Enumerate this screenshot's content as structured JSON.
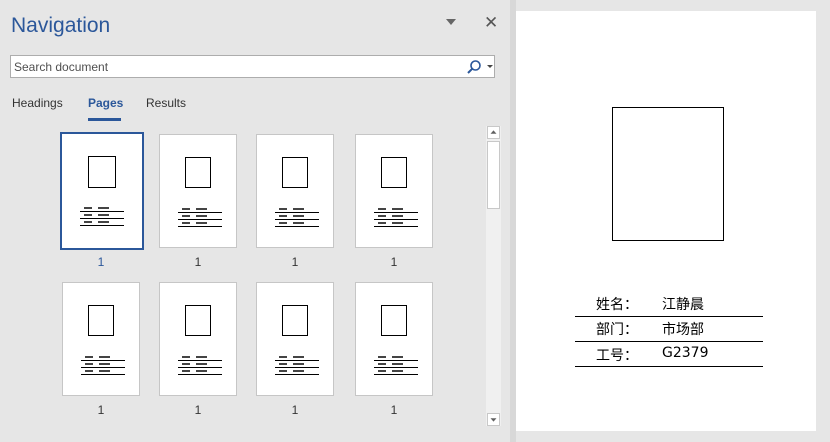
{
  "navigation": {
    "title": "Navigation",
    "search_placeholder": "Search document",
    "tabs": [
      {
        "label": "Headings",
        "active": false
      },
      {
        "label": "Pages",
        "active": true
      },
      {
        "label": "Results",
        "active": false
      }
    ],
    "thumbnails": [
      {
        "page_label": "1",
        "selected": true
      },
      {
        "page_label": "1",
        "selected": false
      },
      {
        "page_label": "1",
        "selected": false
      },
      {
        "page_label": "1",
        "selected": false
      },
      {
        "page_label": "1",
        "selected": false
      },
      {
        "page_label": "1",
        "selected": false
      },
      {
        "page_label": "1",
        "selected": false
      },
      {
        "page_label": "1",
        "selected": false
      }
    ]
  },
  "document": {
    "fields": [
      {
        "label": "姓名：",
        "value": "江静晨"
      },
      {
        "label": "部门：",
        "value": "市场部"
      },
      {
        "label": "工号：",
        "value": "G2379"
      }
    ]
  },
  "colors": {
    "accent": "#2b579a",
    "pane_background": "#e6e6e6",
    "page": "#ffffff"
  },
  "icons": {
    "search": "search-icon",
    "dropdown": "chevron-down-icon",
    "close": "close-icon",
    "pane_options": "pane-options-icon"
  }
}
